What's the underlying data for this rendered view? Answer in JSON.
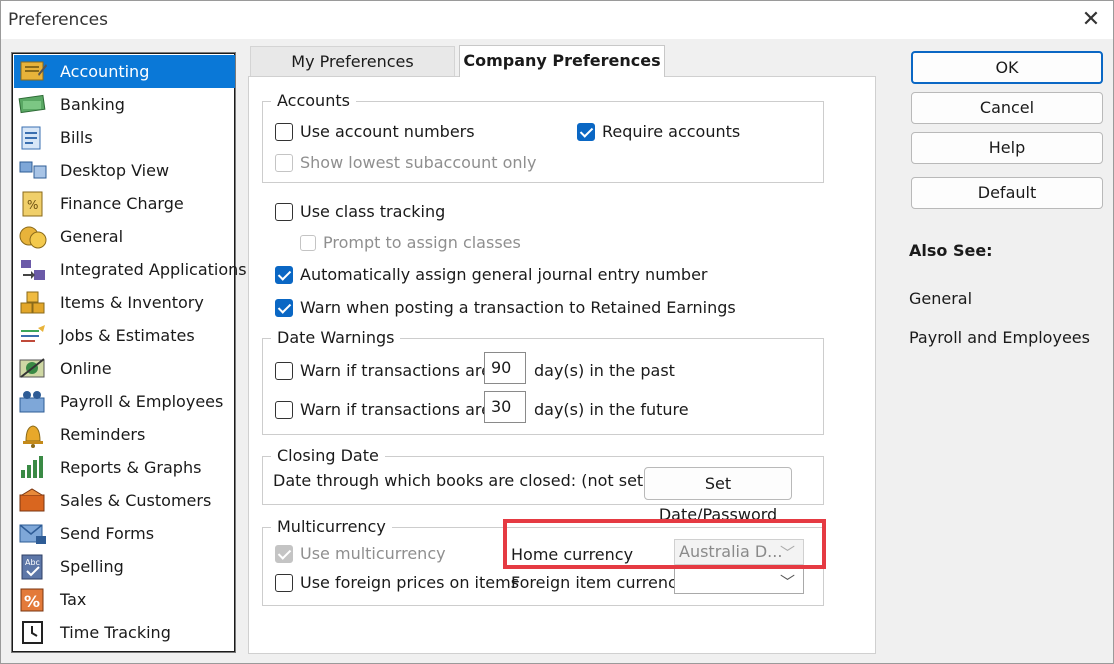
{
  "window": {
    "title": "Preferences"
  },
  "sidebar": {
    "items": [
      {
        "label": "Accounting",
        "icon": "accounting-icon",
        "selected": true
      },
      {
        "label": "Banking",
        "icon": "banking-icon"
      },
      {
        "label": "Bills",
        "icon": "bills-icon"
      },
      {
        "label": "Desktop View",
        "icon": "desktop-view-icon"
      },
      {
        "label": "Finance Charge",
        "icon": "finance-charge-icon"
      },
      {
        "label": "General",
        "icon": "general-icon"
      },
      {
        "label": "Integrated Applications",
        "icon": "integrated-applications-icon"
      },
      {
        "label": "Items & Inventory",
        "icon": "items-inventory-icon"
      },
      {
        "label": "Jobs & Estimates",
        "icon": "jobs-estimates-icon"
      },
      {
        "label": "Online",
        "icon": "online-icon"
      },
      {
        "label": "Payroll & Employees",
        "icon": "payroll-employees-icon"
      },
      {
        "label": "Reminders",
        "icon": "reminders-icon"
      },
      {
        "label": "Reports & Graphs",
        "icon": "reports-graphs-icon"
      },
      {
        "label": "Sales & Customers",
        "icon": "sales-customers-icon"
      },
      {
        "label": "Send Forms",
        "icon": "send-forms-icon"
      },
      {
        "label": "Spelling",
        "icon": "spelling-icon"
      },
      {
        "label": "Tax",
        "icon": "tax-icon"
      },
      {
        "label": "Time Tracking",
        "icon": "time-tracking-icon"
      }
    ]
  },
  "tabs": {
    "my": "My Preferences",
    "company": "Company Preferences"
  },
  "accounts": {
    "title": "Accounts",
    "use_account_numbers": "Use account numbers",
    "require_accounts": "Require accounts",
    "show_lowest": "Show lowest subaccount only"
  },
  "options": {
    "class_tracking": "Use class tracking",
    "prompt_classes": "Prompt to assign classes",
    "auto_journal": "Automatically assign general journal entry number",
    "warn_retained": "Warn when posting a transaction to Retained Earnings"
  },
  "date_warnings": {
    "title": "Date Warnings",
    "warn_label": "Warn if transactions are",
    "past_days": "90",
    "past_suffix": "day(s) in the past",
    "future_days": "30",
    "future_suffix": "day(s) in the future"
  },
  "closing": {
    "title": "Closing Date",
    "text": "Date through which books are closed: (not set)",
    "button": "Set Date/Password"
  },
  "multicurrency": {
    "title": "Multicurrency",
    "use_multicurrency": "Use multicurrency",
    "foreign_prices": "Use foreign prices on items",
    "home_currency_label": "Home currency",
    "home_currency_value": "Australia D...",
    "foreign_item_label": "Foreign item currency",
    "foreign_item_value": ""
  },
  "buttons": {
    "ok": "OK",
    "cancel": "Cancel",
    "help": "Help",
    "default": "Default"
  },
  "also_see": {
    "title": "Also See:",
    "links": [
      "General",
      "Payroll and Employees"
    ]
  },
  "colors": {
    "accent": "#0a67c4",
    "selection": "#0a78d7",
    "highlight": "#e53a42"
  }
}
